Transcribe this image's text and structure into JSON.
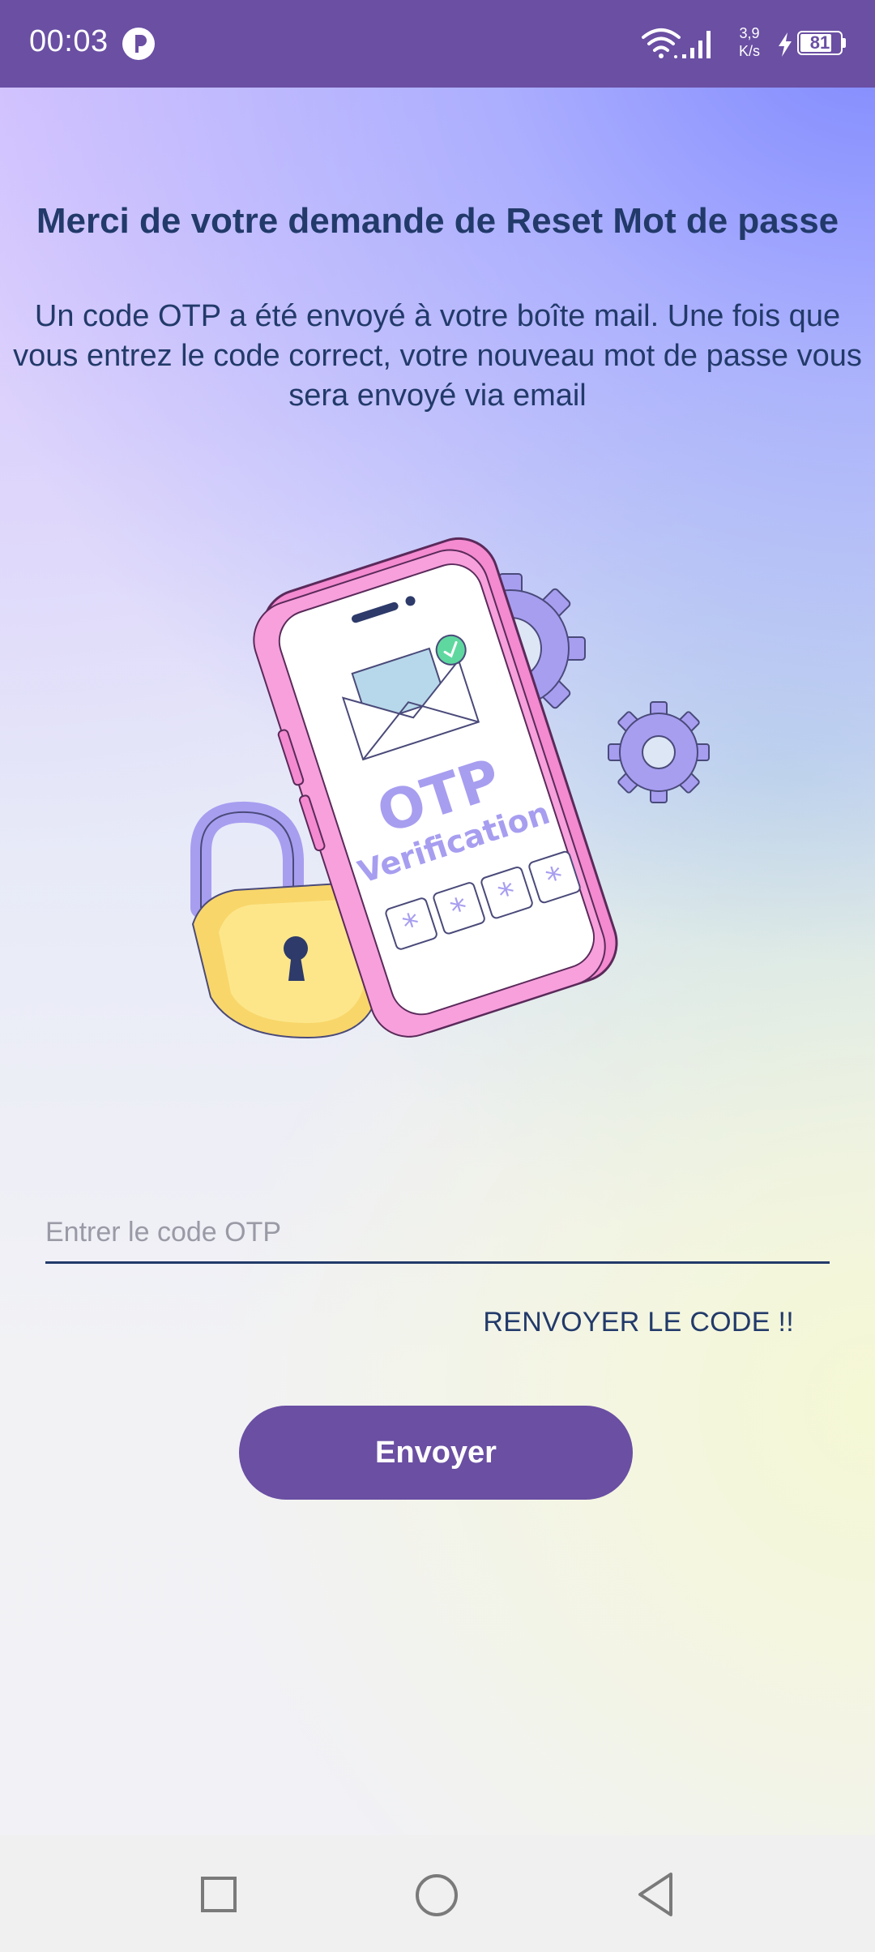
{
  "status_bar": {
    "time": "00:03",
    "network_speed_value": "3,9",
    "network_speed_unit": "K/s",
    "battery_level": "81",
    "battery_fraction": 0.81,
    "icons": [
      "app-notification-icon",
      "wifi-icon",
      "cellular-signal-icon",
      "charging-icon",
      "battery-icon"
    ]
  },
  "page": {
    "title": "Merci de votre demande de Reset Mot de passe",
    "message": "Un code OTP a été envoyé à votre boîte mail. Une fois que vous entrez le code correct, votre nouveau mot de passe vous sera envoyé via email"
  },
  "illustration": {
    "otp_text": "OTP",
    "verification_text": "Verification",
    "code_boxes": [
      "*",
      "*",
      "*",
      "*"
    ]
  },
  "form": {
    "otp_value": "",
    "otp_placeholder": "Entrer le code OTP",
    "resend_label": "RENVOYER LE CODE !!",
    "submit_label": "Envoyer"
  },
  "nav_bar": {
    "icons": [
      "recent-apps-icon",
      "home-icon",
      "back-icon"
    ]
  },
  "colors": {
    "primary": "#6a4fa3",
    "text_dark": "#223a6a",
    "placeholder": "#9a9aa6",
    "nav_background": "#f0f0f0"
  }
}
